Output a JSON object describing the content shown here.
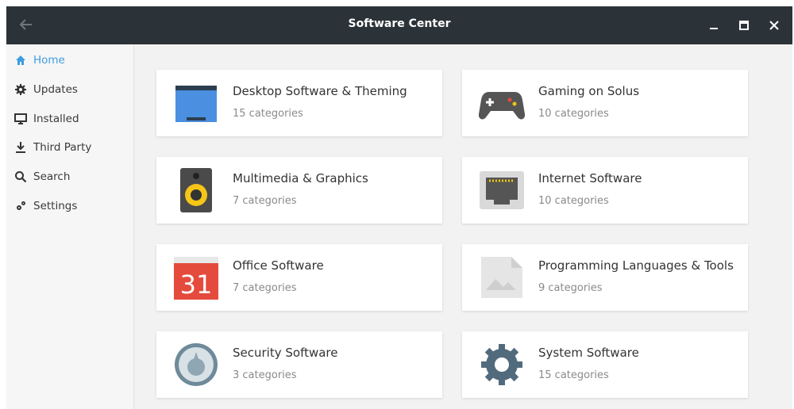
{
  "window": {
    "title": "Software Center"
  },
  "sidebar": {
    "items": [
      {
        "label": "Home"
      },
      {
        "label": "Updates"
      },
      {
        "label": "Installed"
      },
      {
        "label": "Third Party"
      },
      {
        "label": "Search"
      },
      {
        "label": "Settings"
      }
    ]
  },
  "categories": [
    {
      "name": "Desktop Software & Theming",
      "count": "15 categories"
    },
    {
      "name": "Gaming on Solus",
      "count": "10 categories"
    },
    {
      "name": "Multimedia & Graphics",
      "count": "7 categories"
    },
    {
      "name": "Internet Software",
      "count": "10 categories"
    },
    {
      "name": "Office Software",
      "count": "7 categories",
      "icon_text": "31"
    },
    {
      "name": "Programming Languages & Tools",
      "count": "9 categories"
    },
    {
      "name": "Security Software",
      "count": "3 categories"
    },
    {
      "name": "System Software",
      "count": "15 categories"
    }
  ],
  "colors": {
    "titlebar": "#2c3338",
    "accent": "#3d9de0"
  }
}
